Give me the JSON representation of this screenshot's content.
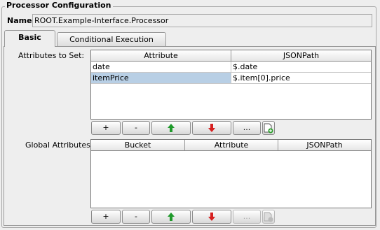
{
  "panel": {
    "title": "Processor Configuration",
    "name_label": "Name:",
    "name_value": "ROOT.Example-Interface.Processor"
  },
  "tabs": [
    {
      "label": "Basic",
      "selected": true
    },
    {
      "label": "Conditional Execution",
      "selected": false
    }
  ],
  "attributes_to_set": {
    "label": "Attributes to Set:",
    "columns": [
      "Attribute",
      "JSONPath"
    ],
    "rows": [
      {
        "attribute": "date",
        "jsonpath": "$.date",
        "selected": false
      },
      {
        "attribute": "itemPrice",
        "jsonpath": "$.item[0].price",
        "selected": true
      }
    ],
    "buttons": {
      "add": "+",
      "remove": "-",
      "move_up": "up-arrow-icon",
      "move_down": "down-arrow-icon",
      "edit": "...",
      "add_doc": "add-document-icon"
    }
  },
  "global_attributes": {
    "label": "Global Attributes:",
    "columns": [
      "Bucket",
      "Attribute",
      "JSONPath"
    ],
    "rows": [],
    "buttons": {
      "add": "+",
      "remove": "-",
      "move_up": "up-arrow-icon",
      "move_down": "down-arrow-icon",
      "edit": "...",
      "add_doc": "add-document-icon"
    }
  },
  "colors": {
    "selection": "#b8cfe5",
    "arrow_up": "#1f9a2b",
    "arrow_down": "#d62020"
  }
}
